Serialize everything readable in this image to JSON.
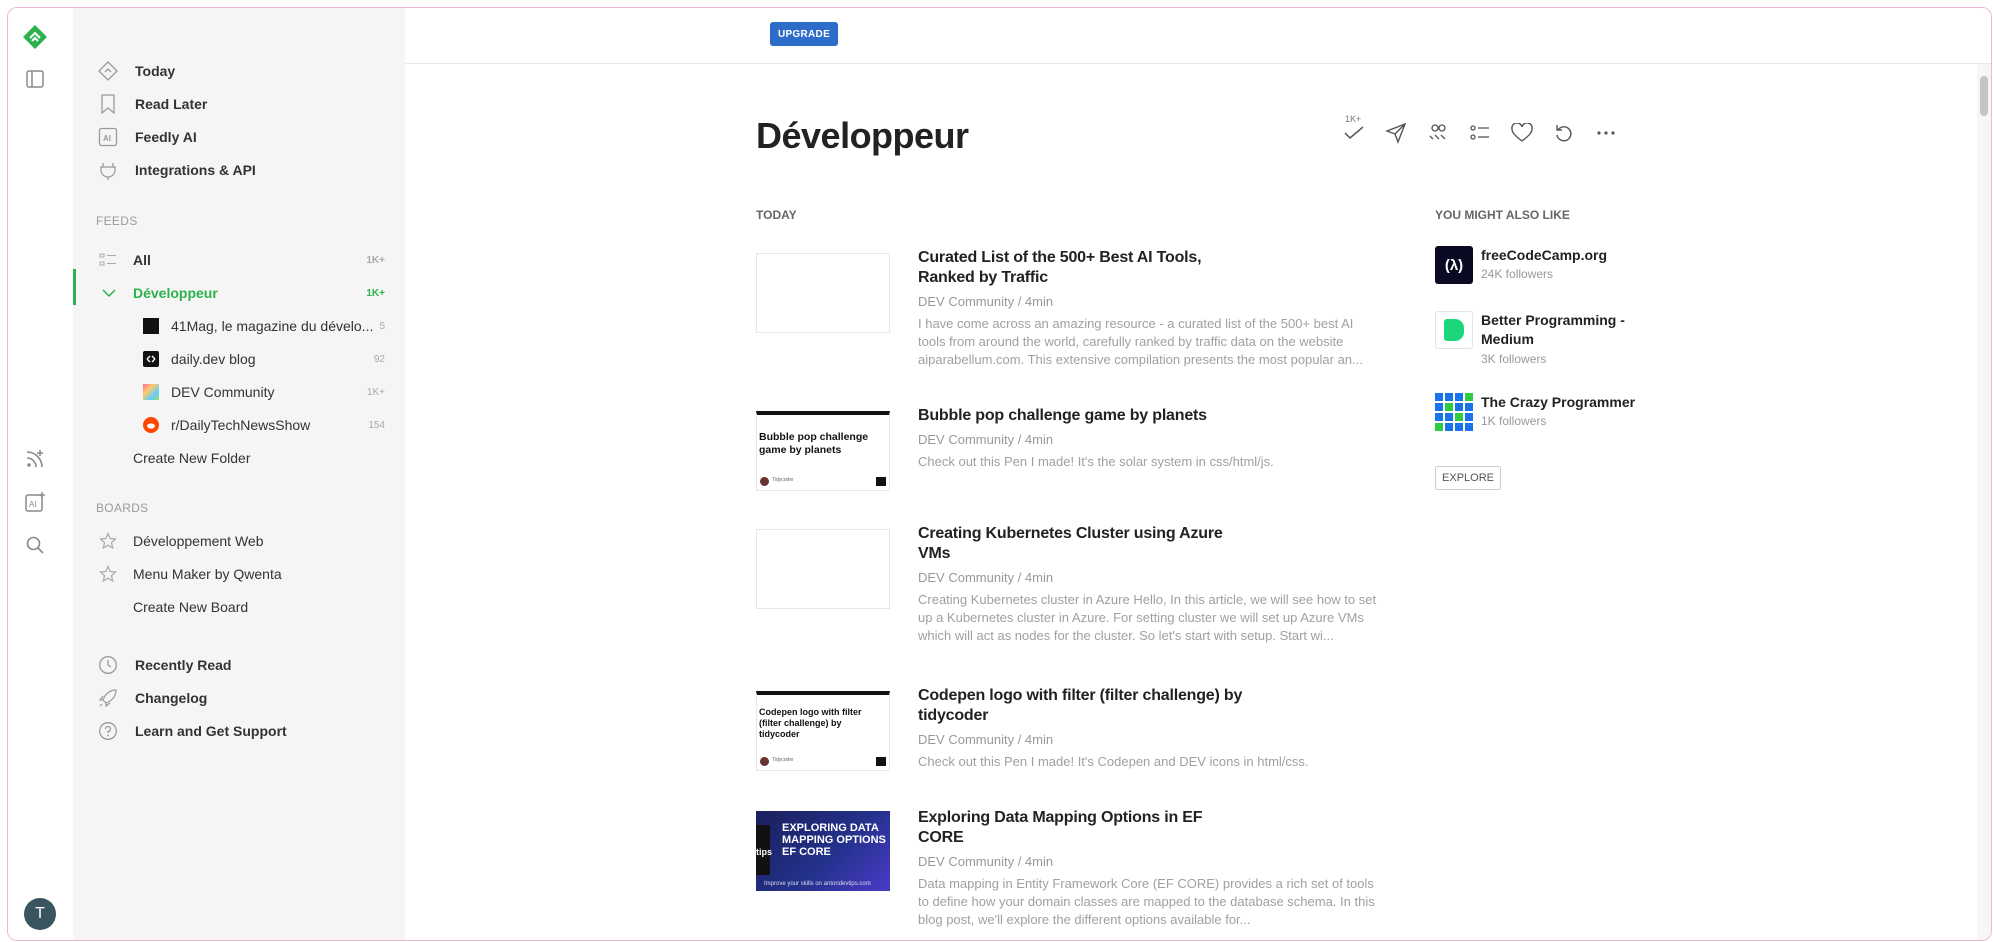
{
  "topbar": {
    "upgrade_label": "UPGRADE"
  },
  "sidebar": {
    "nav": [
      {
        "label": "Today",
        "icon": "today-icon"
      },
      {
        "label": "Read Later",
        "icon": "bookmark-icon"
      },
      {
        "label": "Feedly AI",
        "icon": "ai-icon"
      },
      {
        "label": "Integrations & API",
        "icon": "plug-icon"
      }
    ],
    "feeds_title": "FEEDS",
    "all": {
      "label": "All",
      "count": "1K+"
    },
    "folder": {
      "label": "Développeur",
      "count": "1K+"
    },
    "sources": [
      {
        "label": "41Mag, le magazine du dévelo...",
        "count": "5"
      },
      {
        "label": "daily.dev blog",
        "count": "92"
      },
      {
        "label": "DEV Community",
        "count": "1K+"
      },
      {
        "label": "r/DailyTechNewsShow",
        "count": "154"
      }
    ],
    "create_folder": "Create New Folder",
    "boards_title": "BOARDS",
    "boards": [
      {
        "label": "Développement Web"
      },
      {
        "label": "Menu Maker by Qwenta"
      }
    ],
    "create_board": "Create New Board",
    "bottom": [
      {
        "label": "Recently Read",
        "icon": "clock-icon"
      },
      {
        "label": "Changelog",
        "icon": "rocket-icon"
      },
      {
        "label": "Learn and Get Support",
        "icon": "help-icon"
      }
    ]
  },
  "user": {
    "initial": "T"
  },
  "main": {
    "title": "Développeur",
    "mark_read_count": "1K+",
    "section_today": "TODAY",
    "articles": [
      {
        "title": "Curated List of the 500+ Best AI Tools, Ranked by Traffic",
        "meta": "DEV Community / 4min",
        "desc": "I have come across an amazing resource - a curated list of the 500+ best AI tools from around the world, carefully ranked by traffic data on the website aiparabellum.com. This extensive compilation presents the most popular an..."
      },
      {
        "title": "Bubble pop challenge game by planets",
        "meta": "DEV Community / 4min",
        "desc": "Check out this Pen I made! It's the solar system in css/html/js.",
        "thumb_text": "Bubble pop challenge game by planets",
        "thumb_author": "Tidycoder"
      },
      {
        "title": "Creating Kubernetes Cluster using Azure VMs",
        "meta": "DEV Community / 4min",
        "desc": "Creating Kubernetes cluster in Azure Hello, In this article, we will see how to set up a Kubernetes cluster in Azure. For setting cluster we will set up Azure VMs which will act as nodes for the cluster. So let's start with setup. Start wi..."
      },
      {
        "title": "Codepen logo with filter (filter challenge) by tidycoder",
        "meta": "DEV Community / 4min",
        "desc": "Check out this Pen I made! It's Codepen and DEV icons in html/css.",
        "thumb_text": "Codepen logo with filter (filter challenge) by tidycoder",
        "thumb_author": "Tidycoder"
      },
      {
        "title": "Exploring Data Mapping Options in EF CORE",
        "meta": "DEV Community / 4min",
        "desc": "Data mapping in Entity Framework Core (EF CORE) provides a rich set of tools to define how your domain classes are mapped to the database schema. In this blog post, we'll explore the different options available for...",
        "thumb_text": "EXPLORING DATA MAPPING OPTIONS EF CORE",
        "thumb_side": "tips",
        "thumb_footer": "Improve your skills on antondevtips.com"
      }
    ],
    "section_suggest": "YOU MIGHT ALSO LIKE",
    "suggestions": [
      {
        "name": "freeCodeCamp.org",
        "followers": "24K followers",
        "logo": "(λ)"
      },
      {
        "name": "Better Programming - Medium",
        "followers": "3K followers",
        "logo": "B"
      },
      {
        "name": "The Crazy Programmer",
        "followers": "1K followers"
      }
    ],
    "explore_label": "EXPLORE"
  },
  "colors": {
    "accent": "#2bb24c",
    "upgrade": "#2d6cc9"
  }
}
